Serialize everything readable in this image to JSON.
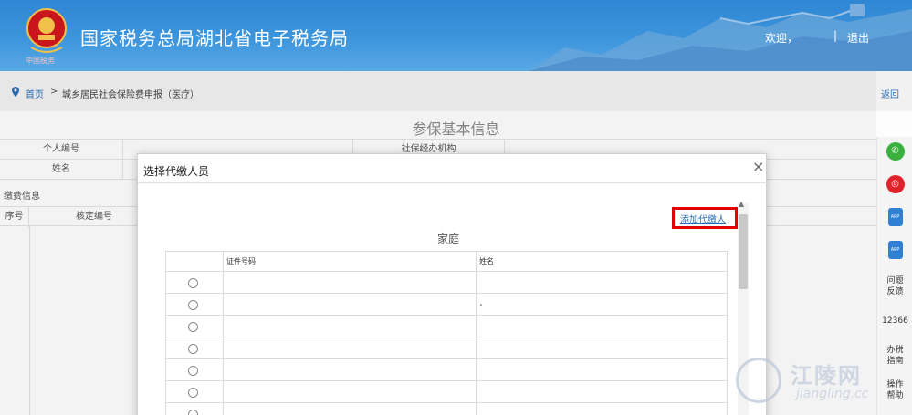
{
  "header": {
    "site_title": "国家税务总局湖北省电子税务局",
    "logo_caption": "中国税务",
    "welcome": "欢迎，",
    "separator": "|",
    "logout": "退出",
    "brand_color": "#2f86d3"
  },
  "breadcrumb": {
    "home": "首页",
    "separator": ">",
    "current": "城乡居民社会保险费申报（医疗）",
    "return": "返回"
  },
  "page": {
    "section_title": "参保基本信息",
    "fields": [
      {
        "label": "个人编号",
        "value": ""
      },
      {
        "label": "社保经办机构",
        "value": ""
      },
      {
        "label": "姓名",
        "value": ""
      }
    ],
    "pay_info_label": "缴费信息",
    "pay_columns": [
      "序号",
      "核定编号"
    ]
  },
  "modal": {
    "title": "选择代缴人员",
    "close": "×",
    "add_payer": "添加代缴人",
    "family_label": "家庭",
    "columns": [
      "证件号码",
      "姓名"
    ],
    "rows": [
      {
        "id": "",
        "name": ""
      },
      {
        "id": "",
        "name": "，"
      },
      {
        "id": "",
        "name": ""
      },
      {
        "id": "",
        "name": ""
      },
      {
        "id": "",
        "name": ""
      },
      {
        "id": "",
        "name": ""
      },
      {
        "id": "",
        "name": ""
      }
    ],
    "highlight_color": "#e30000"
  },
  "sidebar": {
    "items": [
      {
        "icon": "wechat-icon",
        "label": ""
      },
      {
        "icon": "weibo-icon",
        "label": ""
      },
      {
        "icon": "app-icon",
        "label": "APP"
      },
      {
        "icon": "app-icon",
        "label": "APP"
      },
      {
        "icon": "",
        "label": "问题反馈"
      },
      {
        "icon": "",
        "label": "12366"
      },
      {
        "icon": "",
        "label": "办税指南"
      },
      {
        "icon": "",
        "label": "操作帮助"
      }
    ]
  },
  "watermark": {
    "name": "江陵网",
    "url": "jiangling.cc"
  }
}
